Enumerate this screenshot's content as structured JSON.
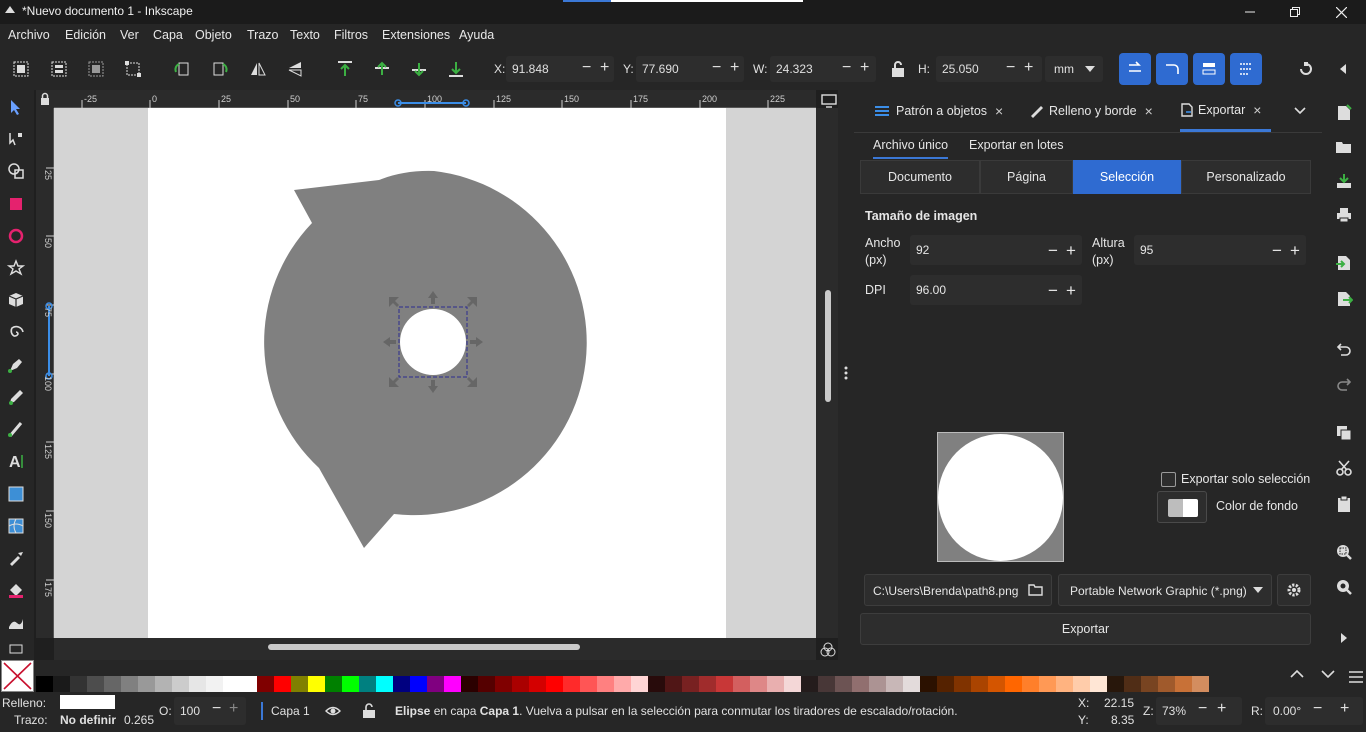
{
  "window": {
    "title": "*Nuevo documento 1 - Inkscape",
    "minimize_icon": "minimize-icon",
    "maximize_icon": "restore-icon",
    "close_icon": "close-icon"
  },
  "menu": [
    "Archivo",
    "Edición",
    "Ver",
    "Capa",
    "Objeto",
    "Trazo",
    "Texto",
    "Filtros",
    "Extensiones",
    "Ayuda"
  ],
  "toolbar": {
    "x_label": "X:",
    "x_value": "91.848",
    "y_label": "Y:",
    "y_value": "77.690",
    "w_label": "W:",
    "w_value": "24.323",
    "h_label": "H:",
    "h_value": "25.050",
    "unit": "mm",
    "minus": "−",
    "plus": "+"
  },
  "ruler": {
    "h_ticks": [
      "-25",
      "0",
      "25",
      "50",
      "75",
      "100",
      "125",
      "150",
      "175",
      "200",
      "225"
    ],
    "v_ticks": [
      "25",
      "50",
      "75",
      "100",
      "125",
      "150",
      "175"
    ]
  },
  "dock": {
    "tabs": [
      {
        "label": "Patrón a objetos",
        "icon": "pattern-icon"
      },
      {
        "label": "Relleno y borde",
        "icon": "fill-stroke-icon"
      },
      {
        "label": "Exportar",
        "icon": "export-icon"
      }
    ],
    "close_glyph": "×",
    "subtabs": [
      "Archivo único",
      "Exportar en lotes"
    ],
    "area_buttons": [
      "Documento",
      "Página",
      "Selección",
      "Personalizado"
    ],
    "selected_area": "Selección",
    "image_size_title": "Tamaño de imagen",
    "width_label_1": "Ancho",
    "width_label_2": "(px)",
    "width_value": "92",
    "height_label_1": "Altura",
    "height_label_2": "(px)",
    "height_value": "95",
    "dpi_label": "DPI",
    "dpi_value": "96.00",
    "export_selection_only": "Exportar solo selección",
    "background_color": "Color de fondo",
    "filename": "C:\\Users\\Brenda\\path8.png",
    "format": "Portable Network Graphic (*.png)",
    "export_button": "Exportar"
  },
  "status": {
    "fill_label": "Relleno:",
    "stroke_label": "Trazo:",
    "stroke_value": "No definir",
    "stroke_width": "0.265",
    "opacity_label": "O:",
    "opacity_value": "100",
    "layer": "Capa 1",
    "message_bold": "Elipse",
    "message_pre": " en capa ",
    "message_layer": "Capa 1",
    "message_post": ". Vuelva a pulsar en la selección para conmutar los tiradores de escalado/rotación.",
    "cursor_x_label": "X:",
    "cursor_x": "22.15",
    "cursor_y_label": "Y:",
    "cursor_y": "8.35",
    "zoom_label": "Z:",
    "zoom": "73%",
    "rotation_label": "R:",
    "rotation": "0.00°"
  },
  "palette": [
    "#000000",
    "#1a1a1a",
    "#333333",
    "#4d4d4d",
    "#666666",
    "#808080",
    "#999999",
    "#b3b3b3",
    "#cccccc",
    "#e6e6e6",
    "#f2f2f2",
    "#ffffff",
    "#ffffff",
    "#800000",
    "#ff0000",
    "#808000",
    "#ffff00",
    "#008000",
    "#00ff00",
    "#008080",
    "#00ffff",
    "#000080",
    "#0000ff",
    "#800080",
    "#ff00ff",
    "#2b0000",
    "#550000",
    "#800000",
    "#aa0000",
    "#d40000",
    "#ff0000",
    "#ff2a2a",
    "#ff5555",
    "#ff8080",
    "#ffaaaa",
    "#ffd5d5",
    "#280b0b",
    "#501616",
    "#782121",
    "#a02c2c",
    "#c83737",
    "#d35f5f",
    "#de8787",
    "#e9afaf",
    "#f4d7d7",
    "#241c1c",
    "#483737",
    "#6c5353",
    "#916f6f",
    "#ac9393",
    "#c8b7b7",
    "#e3dbdb",
    "#2b1100",
    "#552200",
    "#803300",
    "#aa4400",
    "#d45500",
    "#ff6600",
    "#ff7f2a",
    "#ff9955",
    "#ffb380",
    "#ffccaa",
    "#ffe6d5",
    "#28170b",
    "#502d16",
    "#784421",
    "#a05a2c",
    "#c87137",
    "#d38d5f"
  ],
  "colors": {
    "accent": "#2f6bd1",
    "canvas_bg": "#d4d4d4",
    "shape": "#808080"
  }
}
